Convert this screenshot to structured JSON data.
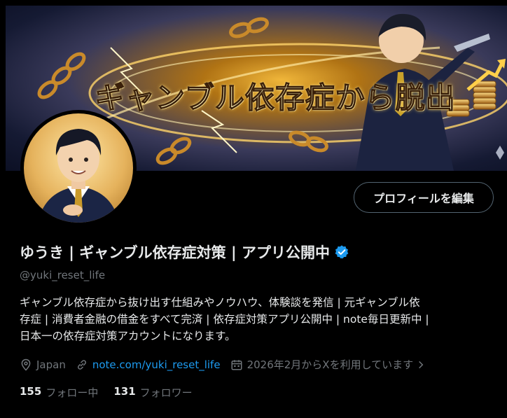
{
  "banner": {
    "title": "ギャンブル依存症から脱出"
  },
  "profile": {
    "edit_button": "プロフィールを編集",
    "display_name": "ゆうき | ギャンブル依存症対策 | アプリ公開中",
    "handle": "@yuki_reset_life",
    "bio_lines": [
      "ギャンブル依存症から抜け出す仕組みやノウハウ、体験談を発信 | 元ギャンブル依",
      "存症 | 消費者金融の借金をすべて完済 | 依存症対策アプリ公開中 | note毎日更新中 |",
      "日本一の依存症対策アカウントになります。"
    ],
    "location": "Japan",
    "website": "note.com/yuki_reset_life",
    "joined": "2026年2月からXを利用しています"
  },
  "stats": {
    "following_count": "155",
    "following_label": "フォロー中",
    "followers_count": "131",
    "followers_label": "フォロワー"
  },
  "colors": {
    "accent": "#1d9bf0",
    "muted": "#71767b",
    "text": "#e7e9ea",
    "background": "#000000"
  }
}
